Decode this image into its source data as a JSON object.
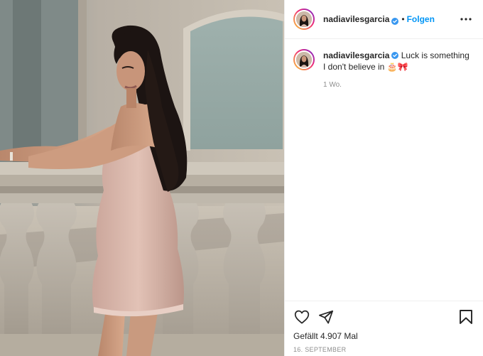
{
  "post": {
    "username": "nadiavilesgarcia",
    "separator": "•",
    "follow_label": "Folgen",
    "caption_line1": "Luck is something",
    "caption_line2": "I don't believe in 🎂🎀",
    "time_ago": "1 Wo.",
    "likes": "Gefällt 4.907 Mal",
    "date": "16. SEPTEMBER"
  },
  "icons": {
    "more": "more-options-icon",
    "verified": "verified-badge-icon",
    "like": "heart-icon",
    "share": "paper-plane-icon",
    "save": "bookmark-icon"
  },
  "colors": {
    "follow": "#0095f6",
    "verified": "#3897f0",
    "text": "#262626",
    "muted": "#8e8e8e",
    "divider": "#efefef"
  }
}
